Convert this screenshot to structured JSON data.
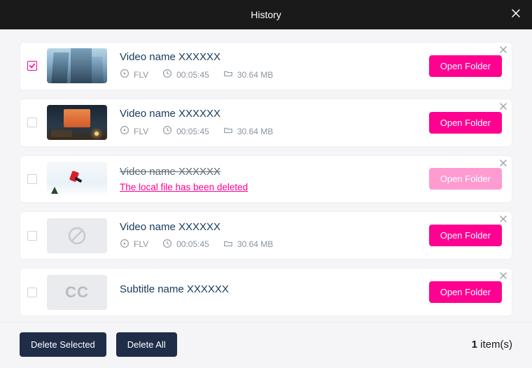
{
  "header": {
    "title": "History"
  },
  "buttons": {
    "open_folder": "Open Folder",
    "delete_selected": "Delete Selected",
    "delete_all": "Delete All"
  },
  "deleted_message": "The local file has been deleted",
  "footer": {
    "count_value": "1",
    "count_suffix": "item(s)"
  },
  "items": [
    {
      "checked": true,
      "thumb": "buildings",
      "title": "Video name XXXXXX",
      "format": "FLV",
      "duration": "00:05:45",
      "size": "30.64 MB",
      "state": "normal"
    },
    {
      "checked": false,
      "thumb": "room",
      "title": "Video name XXXXXX",
      "format": "FLV",
      "duration": "00:05:45",
      "size": "30.64 MB",
      "state": "normal"
    },
    {
      "checked": false,
      "thumb": "ski",
      "title": "Video name XXXXXX",
      "state": "deleted"
    },
    {
      "checked": false,
      "thumb": "placeholder",
      "title": "Video name XXXXXX",
      "format": "FLV",
      "duration": "00:05:45",
      "size": "30.64 MB",
      "state": "normal"
    },
    {
      "checked": false,
      "thumb": "cc",
      "title": "Subtitle name XXXXXX",
      "state": "subtitle"
    }
  ]
}
